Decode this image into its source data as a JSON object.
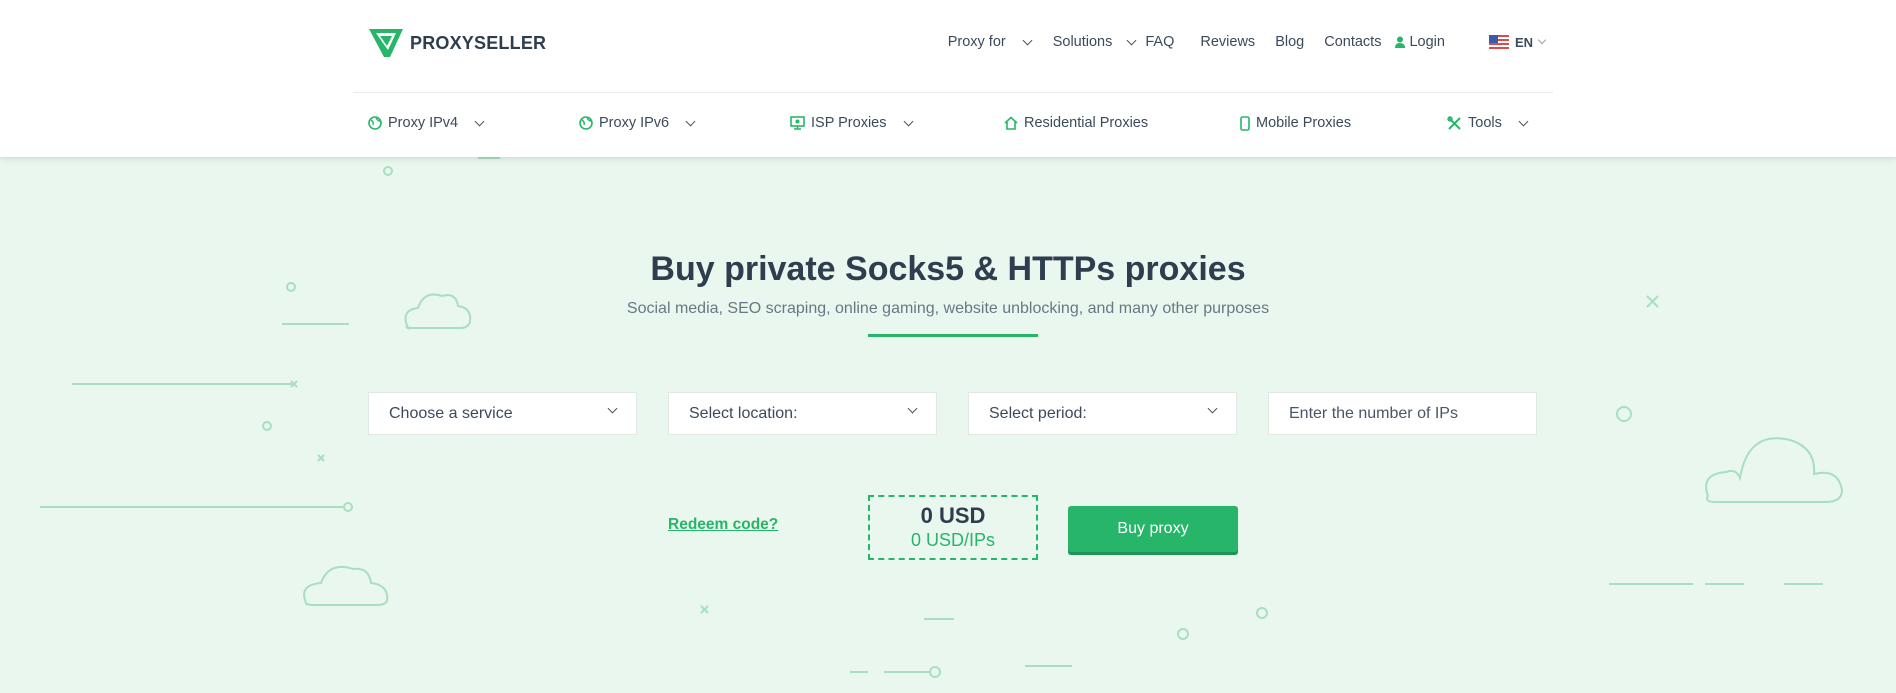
{
  "brand": {
    "name": "PROXYSELLER"
  },
  "top_nav": [
    {
      "label": "Proxy for",
      "dropdown": true
    },
    {
      "label": "Solutions",
      "dropdown": true
    },
    {
      "label": "FAQ",
      "dropdown": false
    },
    {
      "label": "Reviews",
      "dropdown": false
    },
    {
      "label": "Blog",
      "dropdown": false
    },
    {
      "label": "Contacts",
      "dropdown": false
    }
  ],
  "login": {
    "label": "Login",
    "icon": "user-icon"
  },
  "language": {
    "code": "EN",
    "icon": "us-flag-icon"
  },
  "sub_nav": [
    {
      "label": "Proxy IPv4",
      "icon": "globe-icon",
      "dropdown": true
    },
    {
      "label": "Proxy IPv6",
      "icon": "globe-icon",
      "dropdown": true
    },
    {
      "label": "ISP Proxies",
      "icon": "monitor-icon",
      "dropdown": true
    },
    {
      "label": "Residential Proxies",
      "icon": "home-icon",
      "dropdown": false
    },
    {
      "label": "Mobile Proxies",
      "icon": "phone-icon",
      "dropdown": false
    },
    {
      "label": "Tools",
      "icon": "tools-icon",
      "dropdown": true
    }
  ],
  "hero": {
    "title": "Buy private Socks5 & HTTPs proxies",
    "subtitle": "Social media, SEO scraping, online gaming, website unblocking, and many other purposes"
  },
  "form": {
    "service": {
      "value": "Choose a service"
    },
    "location": {
      "value": "Select location:"
    },
    "period": {
      "value": "Select period:"
    },
    "ips": {
      "placeholder": "Enter the number of IPs"
    }
  },
  "redeem_label": "Redeem code?",
  "price": {
    "total": "0 USD",
    "per_ip": "0 USD/IPs"
  },
  "buy_label": "Buy proxy",
  "colors": {
    "accent": "#27b56a",
    "background": "#e9f7ee",
    "text": "#2f3d4f"
  }
}
